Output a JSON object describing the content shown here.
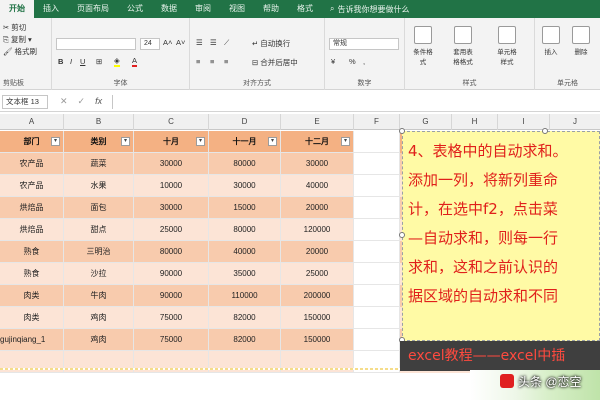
{
  "ribbon_tabs": [
    "开始",
    "插入",
    "页面布局",
    "公式",
    "数据",
    "审阅",
    "视图",
    "帮助",
    "格式"
  ],
  "tell_me": "告诉我你想要做什么",
  "clipboard": {
    "cut": "剪切",
    "copy": "复制",
    "format_painter": "格式刷",
    "label": "剪贴板"
  },
  "font": {
    "size": "24",
    "bold": "B",
    "italic": "I",
    "underline": "U",
    "label": "字体",
    "grow": "A˄",
    "shrink": "A˅",
    "font_color": "A"
  },
  "alignment": {
    "wrap": "自动换行",
    "merge": "合并后居中",
    "label": "对齐方式"
  },
  "number": {
    "format": "常规",
    "label": "数字",
    "percent": "%",
    "comma": ","
  },
  "styles": {
    "conditional": "条件格式",
    "table": "套用表格格式",
    "cell_styles": "单元格样式",
    "label": "样式"
  },
  "cells": {
    "insert": "插入",
    "delete": "删除",
    "label": "单元格"
  },
  "formula_bar": {
    "name_box": "文本框 13",
    "cancel": "✕",
    "enter": "✓",
    "fx": "fx"
  },
  "columns": [
    "A",
    "B",
    "C",
    "D",
    "E",
    "F",
    "G",
    "H",
    "I",
    "J"
  ],
  "table": {
    "headers": [
      "部门",
      "类别",
      "十月",
      "十一月",
      "十二月"
    ],
    "rows": [
      [
        "农产品",
        "蔬菜",
        "30000",
        "80000",
        "30000"
      ],
      [
        "农产品",
        "水果",
        "10000",
        "30000",
        "40000"
      ],
      [
        "烘焙品",
        "面包",
        "30000",
        "15000",
        "20000"
      ],
      [
        "烘焙品",
        "甜点",
        "25000",
        "80000",
        "120000"
      ],
      [
        "熟食",
        "三明治",
        "80000",
        "40000",
        "20000"
      ],
      [
        "熟食",
        "沙拉",
        "90000",
        "35000",
        "25000"
      ],
      [
        "肉类",
        "牛肉",
        "90000",
        "110000",
        "200000"
      ],
      [
        "肉类",
        "鸡肉",
        "75000",
        "82000",
        "150000"
      ],
      [
        "gujinqiang_1",
        "鸡肉",
        "75000",
        "82000",
        "150000"
      ]
    ]
  },
  "overlay_lines": [
    "4、表格中的自动求和。",
    "添加一列，将新列重命",
    "计，在选中f2，点击菜",
    "—自动求和，则每一行",
    "求和，这和之前认识的",
    "据区域的自动求和不同"
  ],
  "caption": "excel教程——excel中插",
  "watermark": "头条 @恋空",
  "colors": {
    "ribbon_green": "#217346",
    "row_salmon": "#f8cbad",
    "row_light": "#fce4d6",
    "overlay_yellow": "#fffaa5",
    "overlay_text": "#e0201b"
  }
}
